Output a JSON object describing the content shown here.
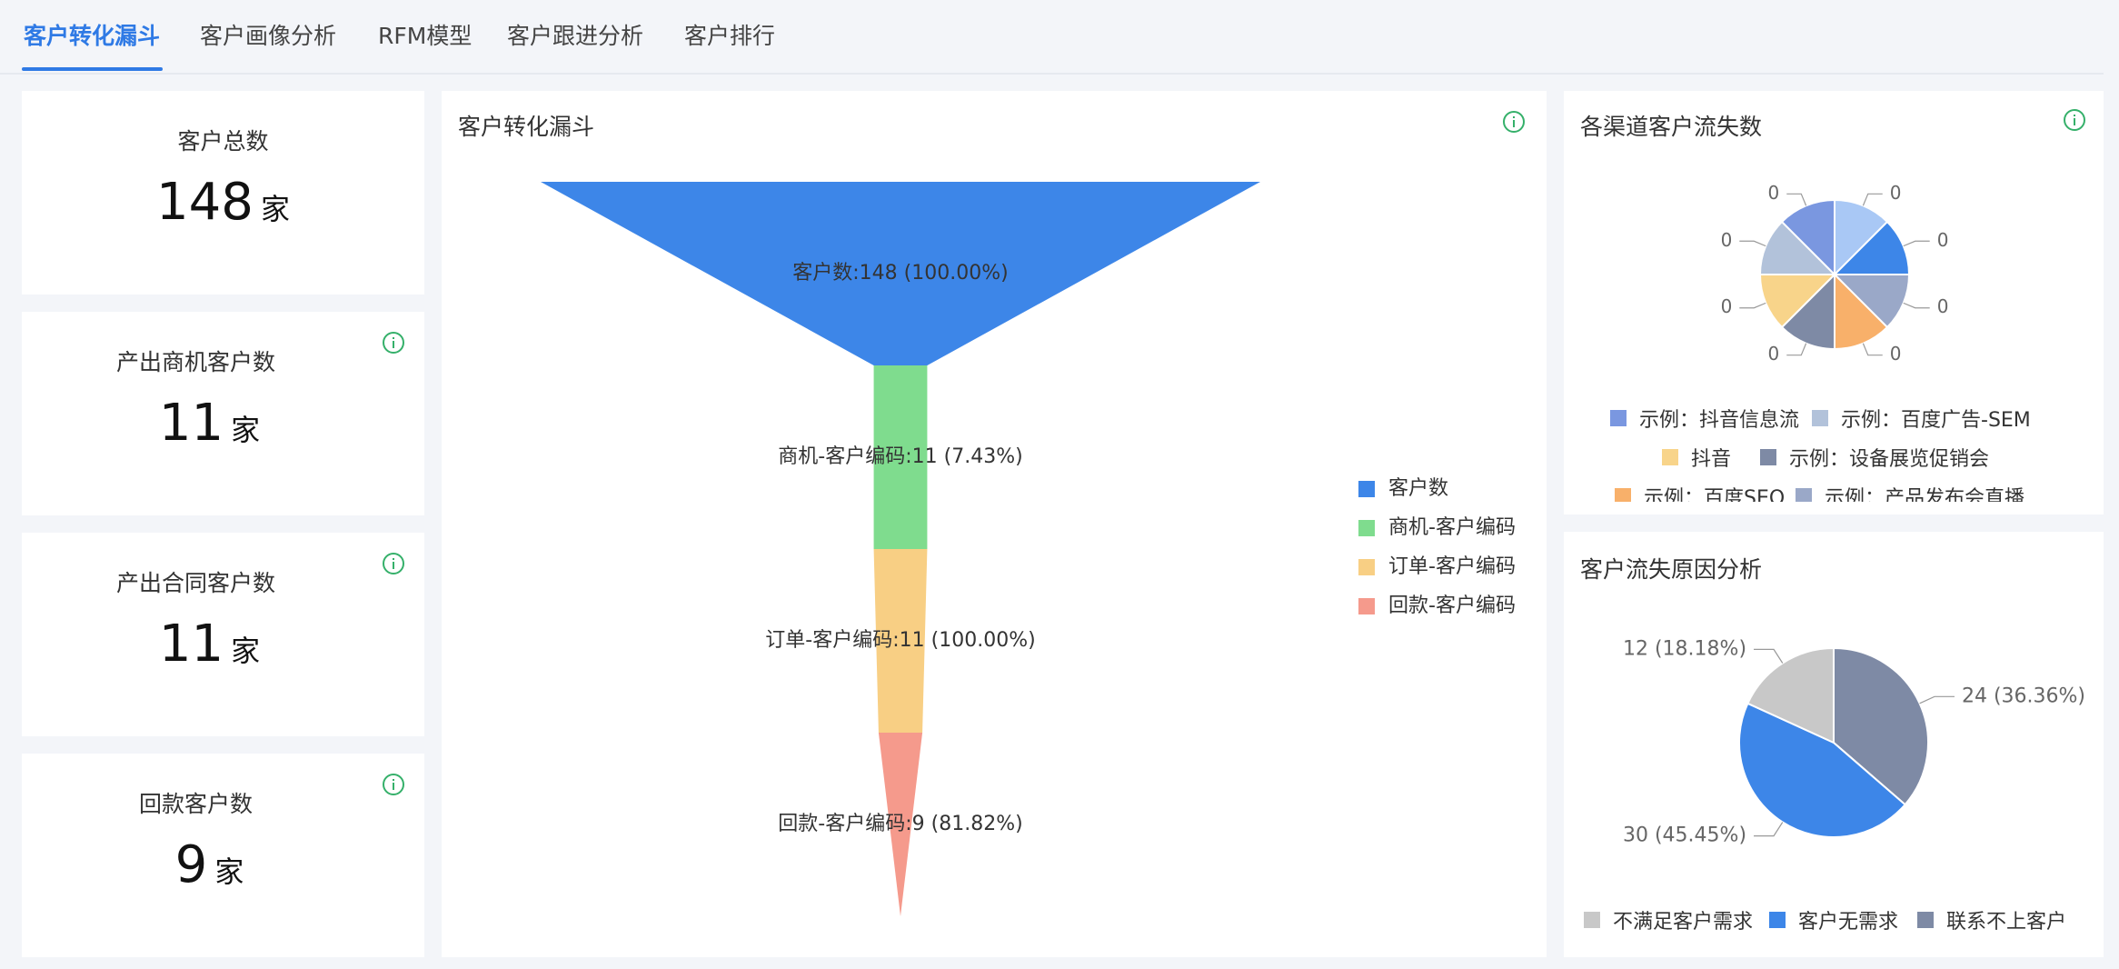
{
  "tabs": [
    {
      "label": "客户转化漏斗",
      "active": true
    },
    {
      "label": "客户画像分析",
      "active": false
    },
    {
      "label": "RFM模型",
      "active": false
    },
    {
      "label": "客户跟进分析",
      "active": false
    },
    {
      "label": "客户排行",
      "active": false
    }
  ],
  "stats": [
    {
      "title": "客户总数",
      "value": "148",
      "unit": "家",
      "info": false
    },
    {
      "title": "产出商机客户数",
      "value": "11",
      "unit": "家",
      "info": true
    },
    {
      "title": "产出合同客户数",
      "value": "11",
      "unit": "家",
      "info": true
    },
    {
      "title": "回款客户数",
      "value": "9",
      "unit": "家",
      "info": true
    }
  ],
  "funnel_card": {
    "title": "客户转化漏斗"
  },
  "channel_card": {
    "title": "各渠道客户流失数"
  },
  "reason_card": {
    "title": "客户流失原因分析"
  },
  "colors": {
    "accent": "#2f7ae5",
    "info": "#35b06a"
  },
  "chart_data": [
    {
      "type": "funnel",
      "title": "",
      "categories": [
        "客户数",
        "商机-客户编码",
        "订单-客户编码",
        "回款-客户编码"
      ],
      "values": [
        148,
        11,
        11,
        9
      ],
      "labels": [
        "客户数:148 (100.00%)",
        "商机-客户编码:11 (7.43%)",
        "订单-客户编码:11 (100.00%)",
        "回款-客户编码:9 (81.82%)"
      ],
      "colors": [
        "#3d86e8",
        "#7fdc8e",
        "#f8cf84",
        "#f59a8c"
      ],
      "legend": "right"
    },
    {
      "type": "pie",
      "title": "",
      "slices": [
        {
          "name": "",
          "value": 0,
          "label": "0",
          "color": "#a9c8f5"
        },
        {
          "name": "",
          "value": 0,
          "label": "0",
          "color": "#3d86e8"
        },
        {
          "name": "",
          "value": 0,
          "label": "0",
          "color": "#9aa8c8"
        },
        {
          "name": "",
          "value": 0,
          "label": "0",
          "color": "#f8b06a"
        },
        {
          "name": "",
          "value": 0,
          "label": "0",
          "color": "#7e8aa5"
        },
        {
          "name": "",
          "value": 0,
          "label": "0",
          "color": "#f8d48a"
        },
        {
          "name": "",
          "value": 0,
          "label": "0",
          "color": "#b2c2da"
        },
        {
          "name": "",
          "value": 0,
          "label": "0",
          "color": "#7a97e0"
        }
      ],
      "legend_entries": [
        {
          "label": "示例：抖音信息流",
          "color": "#7a97e0"
        },
        {
          "label": "示例：百度广告-SEM",
          "color": "#b2c2da"
        },
        {
          "label": "抖音",
          "color": "#f8d48a"
        },
        {
          "label": "示例：设备展览促销会",
          "color": "#7e8aa5"
        },
        {
          "label": "示例：百度SEO",
          "color": "#f8b06a"
        },
        {
          "label": "示例：产品发布会直播",
          "color": "#9aa8c8"
        }
      ],
      "legend": "bottom"
    },
    {
      "type": "pie",
      "title": "",
      "slices": [
        {
          "name": "联系不上客户",
          "value": 24,
          "label": "24 (36.36%)",
          "color": "#7e8aa5"
        },
        {
          "name": "客户无需求",
          "value": 30,
          "label": "30 (45.45%)",
          "color": "#3d86e8"
        },
        {
          "name": "不满足客户需求",
          "value": 12,
          "label": "12 (18.18%)",
          "color": "#c8c8c8"
        }
      ],
      "legend_entries": [
        {
          "label": "不满足客户需求",
          "color": "#c8c8c8"
        },
        {
          "label": "客户无需求",
          "color": "#3d86e8"
        },
        {
          "label": "联系不上客户",
          "color": "#7e8aa5"
        }
      ],
      "legend": "bottom"
    }
  ]
}
